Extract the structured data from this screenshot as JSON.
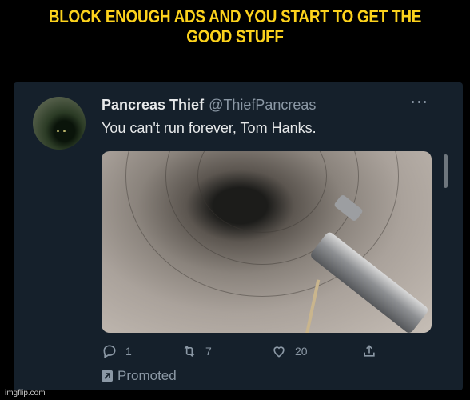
{
  "caption": {
    "line1": "BLOCK ENOUGH ADS AND YOU START TO GET THE",
    "line2": "GOOD STUFF",
    "color": "#fcd21c"
  },
  "tweet": {
    "display_name": "Pancreas Thief",
    "handle": "@ThiefPancreas",
    "text": "You can't run forever, Tom Hanks.",
    "background": "#15202b",
    "more_icon": "more-dots-icon"
  },
  "actions": {
    "reply_count": "1",
    "retweet_count": "7",
    "like_count": "20",
    "icons": [
      "reply-icon",
      "retweet-icon",
      "like-icon",
      "share-icon"
    ]
  },
  "promoted": {
    "label": "Promoted",
    "icon": "promoted-icon"
  },
  "watermark": "imgflip.com"
}
